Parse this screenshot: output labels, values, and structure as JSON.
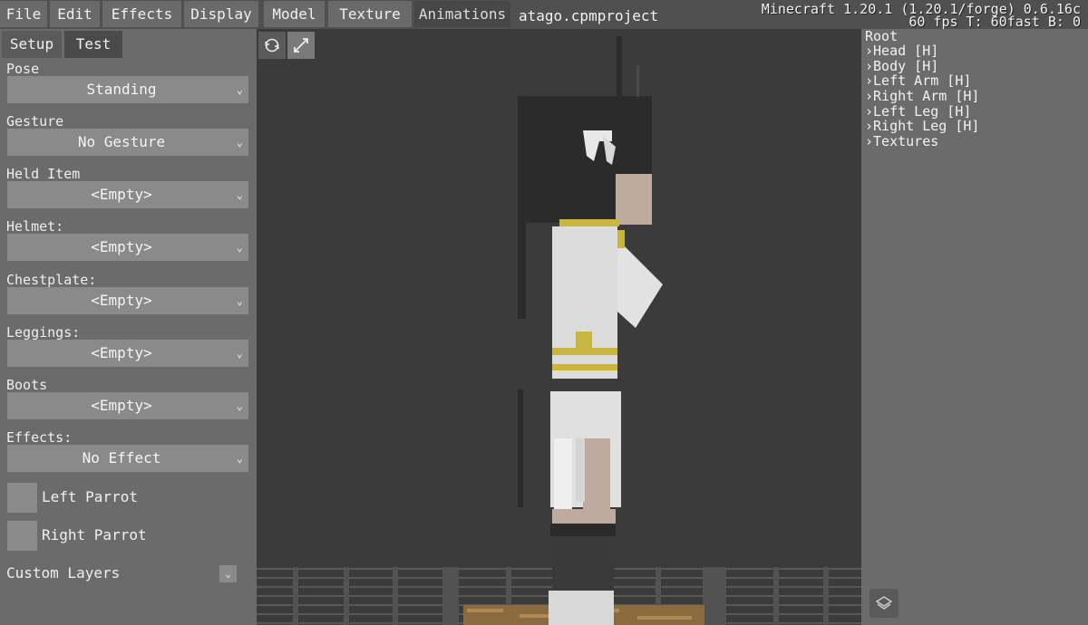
{
  "menubar": {
    "items": [
      "File",
      "Edit",
      "Effects",
      "Display",
      "Model",
      "Texture",
      "Animations"
    ],
    "active": "Animations",
    "project_title": "atago.cpmproject",
    "version": "Minecraft 1.20.1 (1.20.1/forge) 0.6.16c",
    "fps": "60 fps T: 60fast B: 0"
  },
  "left_panel": {
    "tabs": [
      "Setup",
      "Test"
    ],
    "active_tab": "Test",
    "fields": [
      {
        "label": "Pose",
        "value": "Standing"
      },
      {
        "label": "Gesture",
        "value": "No Gesture"
      },
      {
        "label": "Held Item",
        "value": "<Empty>"
      },
      {
        "label": "Helmet:",
        "value": "<Empty>"
      },
      {
        "label": "Chestplate:",
        "value": "<Empty>"
      },
      {
        "label": "Leggings:",
        "value": "<Empty>"
      },
      {
        "label": "Boots",
        "value": "<Empty>"
      },
      {
        "label": "Effects:",
        "value": "No Effect"
      }
    ],
    "checkboxes": [
      "Left Parrot",
      "Right Parrot"
    ],
    "custom_layers_label": "Custom Layers"
  },
  "viewport": {
    "tools": [
      "rotate-view-icon",
      "pan-view-icon"
    ]
  },
  "right_panel": {
    "tree": [
      "Root",
      "Head [H]",
      "Body [H]",
      "Left Arm [H]",
      "Right Arm [H]",
      "Left Leg [H]",
      "Right Leg [H]",
      "Textures"
    ]
  },
  "colors": {
    "panel": "#6b6b6b",
    "menubar": "#505050",
    "viewport": "#3b3b3b",
    "dropdown": "#8a8a8a",
    "skin_white": "#dedede",
    "hair": "#2a2a2a",
    "gold": "#c9b640"
  }
}
